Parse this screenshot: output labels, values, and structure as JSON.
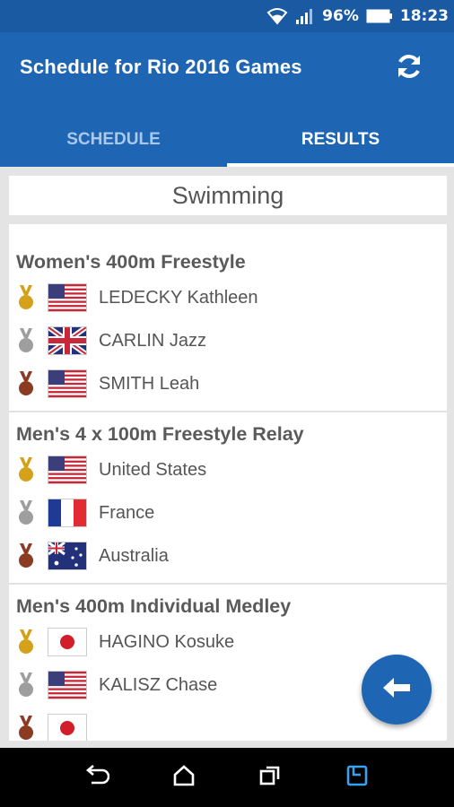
{
  "status_bar": {
    "battery": "96%",
    "time": "18:23"
  },
  "app_bar": {
    "title": "Schedule for Rio 2016 Games"
  },
  "tabs": [
    {
      "label": "SCHEDULE",
      "active": false
    },
    {
      "label": "RESULTS",
      "active": true
    }
  ],
  "sport": "Swimming",
  "events": [
    {
      "title": "Women's 400m Freestyle",
      "results": [
        {
          "medal": "gold",
          "flag": "usa",
          "name": "LEDECKY Kathleen"
        },
        {
          "medal": "silver",
          "flag": "gbr",
          "name": "CARLIN Jazz"
        },
        {
          "medal": "bronze",
          "flag": "usa",
          "name": "SMITH Leah"
        }
      ]
    },
    {
      "title": "Men's 4 x 100m Freestyle Relay",
      "results": [
        {
          "medal": "gold",
          "flag": "usa",
          "name": "United States"
        },
        {
          "medal": "silver",
          "flag": "fra",
          "name": "France"
        },
        {
          "medal": "bronze",
          "flag": "aus",
          "name": "Australia"
        }
      ]
    },
    {
      "title": "Men's 400m Individual Medley",
      "results": [
        {
          "medal": "gold",
          "flag": "jpn",
          "name": "HAGINO Kosuke"
        },
        {
          "medal": "silver",
          "flag": "usa",
          "name": "KALISZ Chase"
        },
        {
          "medal": "bronze",
          "flag": "jpn",
          "name": ""
        }
      ]
    }
  ],
  "colors": {
    "primary": "#1e66b4",
    "status_bar": "#1a5aa3",
    "gold": "#d4a21a",
    "silver": "#9e9e9e",
    "bronze": "#8a3b22"
  },
  "icons": {
    "refresh": "refresh-icon",
    "fab": "back-arrow-icon",
    "nav": [
      "back-icon",
      "home-icon",
      "recents-icon",
      "screenshot-icon"
    ]
  }
}
